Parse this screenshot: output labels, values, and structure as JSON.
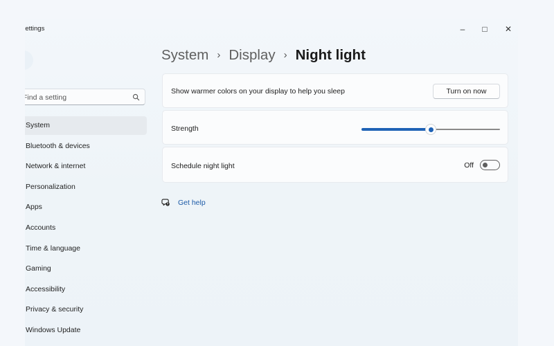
{
  "window": {
    "title": "Settings",
    "controls": {
      "minimize": "–",
      "maximize": "□",
      "close": "✕"
    }
  },
  "sidebar": {
    "search": {
      "placeholder": "Find a setting",
      "icon": "search-icon"
    },
    "items": [
      {
        "label": "System",
        "selected": true
      },
      {
        "label": "Bluetooth & devices"
      },
      {
        "label": "Network & internet"
      },
      {
        "label": "Personalization"
      },
      {
        "label": "Apps"
      },
      {
        "label": "Accounts"
      },
      {
        "label": "Time & language"
      },
      {
        "label": "Gaming"
      },
      {
        "label": "Accessibility"
      },
      {
        "label": "Privacy & security"
      },
      {
        "label": "Windows Update"
      }
    ]
  },
  "breadcrumb": {
    "items": [
      "System",
      "Display",
      "Night light"
    ],
    "separator": "›"
  },
  "settings": {
    "warmer": {
      "label": "Show warmer colors on your display to help you sleep",
      "button": "Turn on now"
    },
    "strength": {
      "label": "Strength",
      "value_fraction": 0.5
    },
    "schedule": {
      "label": "Schedule night light",
      "state": "Off",
      "on": false
    }
  },
  "help": {
    "label": "Get help",
    "icon": "help-chat-icon"
  },
  "colors": {
    "accent": "#1f63b6",
    "link": "#1c5aa7"
  }
}
